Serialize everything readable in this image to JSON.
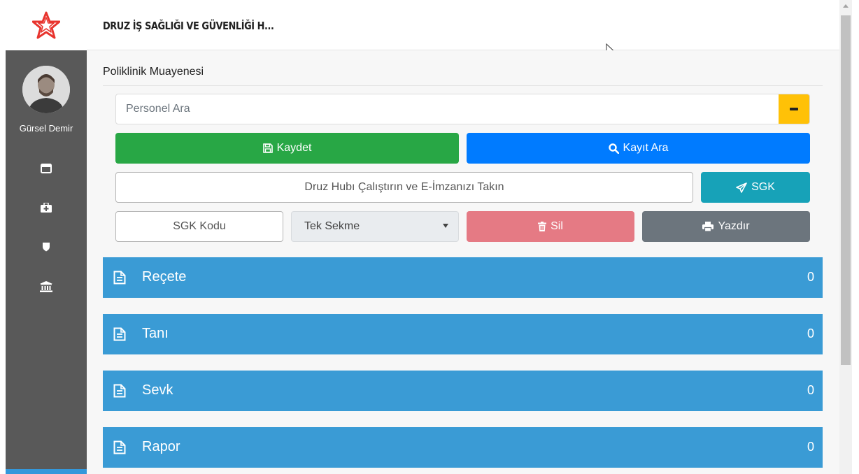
{
  "app": {
    "title": "DRUZ İŞ SAĞLIĞI VE GÜVENLİĞİ H..."
  },
  "user": {
    "name": "Gürsel Demir"
  },
  "sidebar": {
    "icons": [
      "window-icon",
      "first-aid-kit-icon",
      "shield-icon",
      "bank-icon"
    ]
  },
  "page": {
    "title": "Poliklinik Muayenesi"
  },
  "search": {
    "placeholder": "Personel Ara",
    "value": ""
  },
  "buttons": {
    "save": "Kaydet",
    "find_record": "Kayıt Ara",
    "e_signature": "Druz Hubı Çalıştırın ve E-İmzanızı Takın",
    "sgk": "SGK",
    "sgk_code": "SGK Kodu",
    "delete": "Sil",
    "print": "Yazdır"
  },
  "tab_select": {
    "selected": "Tek Sekme"
  },
  "panels": [
    {
      "label": "Reçete",
      "count": "0"
    },
    {
      "label": "Tanı",
      "count": "0"
    },
    {
      "label": "Sevk",
      "count": "0"
    },
    {
      "label": "Rapor",
      "count": "0"
    }
  ],
  "colors": {
    "sidebar": "#595959",
    "save": "#28a745",
    "find": "#007bff",
    "sgk": "#17a2b8",
    "delete": "#e57a84",
    "print": "#6c757d",
    "panel": "#3a9bd5",
    "search_toggle": "#ffc107"
  }
}
